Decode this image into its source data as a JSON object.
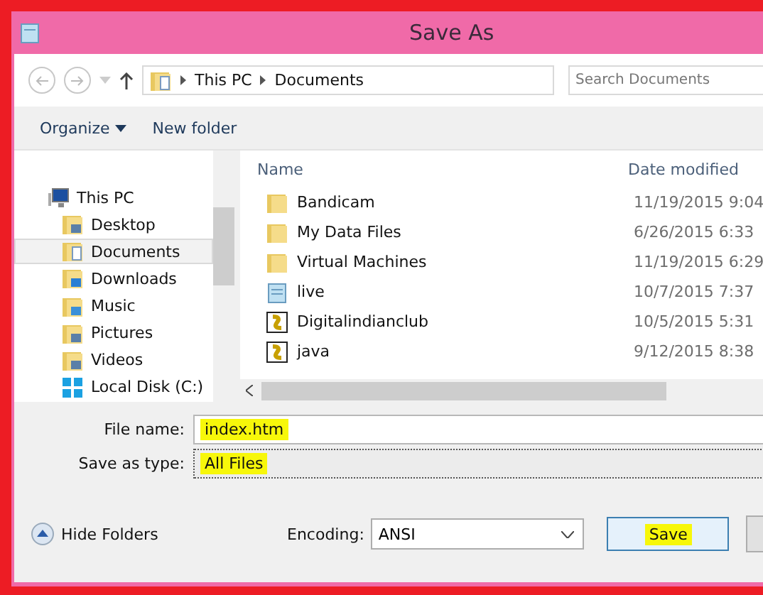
{
  "window": {
    "title": "Save As"
  },
  "address": {
    "segments": [
      "This PC",
      "Documents"
    ],
    "search_placeholder": "Search Documents"
  },
  "toolbar": {
    "organize": "Organize",
    "new_folder": "New folder"
  },
  "nav": [
    {
      "label": "This PC",
      "kind": "pc",
      "selected": false,
      "children": [
        {
          "label": "Desktop",
          "kind": "desktop",
          "selected": false
        },
        {
          "label": "Documents",
          "kind": "documents",
          "selected": true
        },
        {
          "label": "Downloads",
          "kind": "downloads",
          "selected": false
        },
        {
          "label": "Music",
          "kind": "music",
          "selected": false
        },
        {
          "label": "Pictures",
          "kind": "pictures",
          "selected": false
        },
        {
          "label": "Videos",
          "kind": "videos",
          "selected": false
        },
        {
          "label": "Local Disk (C:)",
          "kind": "disk",
          "selected": false
        }
      ]
    }
  ],
  "columns": [
    "Name",
    "Date modified"
  ],
  "files": [
    {
      "name": "Bandicam",
      "date": "11/19/2015 9:04",
      "kind": "folder"
    },
    {
      "name": "My Data Files",
      "date": "6/26/2015 6:33",
      "kind": "folder"
    },
    {
      "name": "Virtual Machines",
      "date": "11/19/2015 6:29",
      "kind": "folder"
    },
    {
      "name": "live",
      "date": "10/7/2015 7:37",
      "kind": "text"
    },
    {
      "name": "Digitalindianclub",
      "date": "10/5/2015 5:31",
      "kind": "script"
    },
    {
      "name": "java",
      "date": "9/12/2015 8:38",
      "kind": "script"
    }
  ],
  "form": {
    "file_name_label": "File name:",
    "file_name": "index.htm",
    "file_name_highlighted": true,
    "type_label": "Save as type:",
    "type": "All Files",
    "type_highlighted": true
  },
  "footer": {
    "hide_folders": "Hide Folders",
    "encoding_label": "Encoding:",
    "encoding": "ANSI",
    "save": "Save",
    "save_highlighted": true
  }
}
